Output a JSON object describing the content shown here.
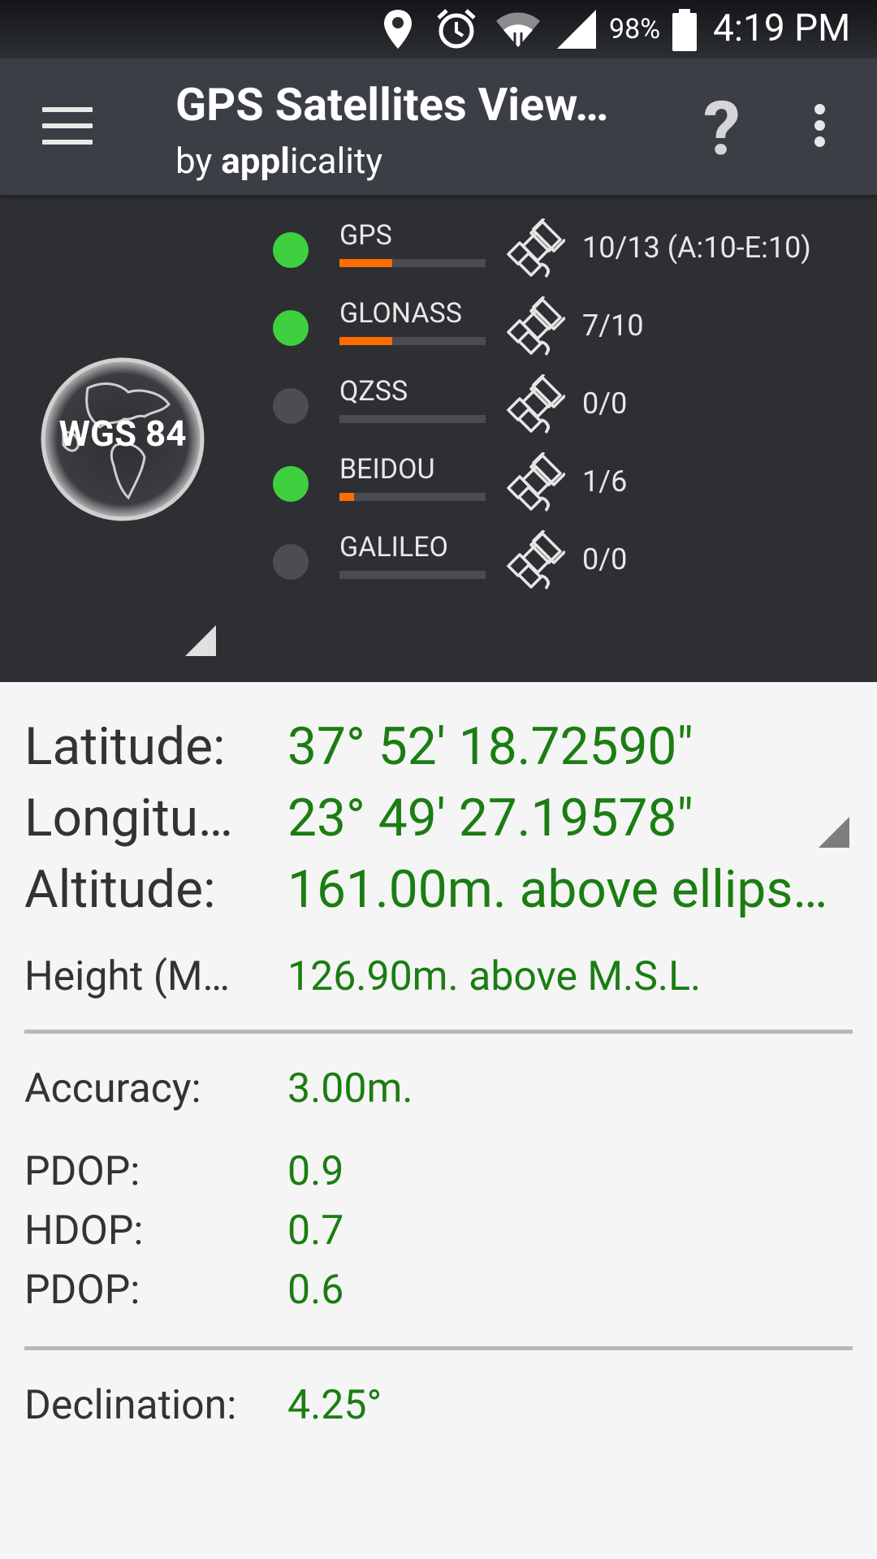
{
  "status_bar": {
    "battery_percent": "98%",
    "time": "4:19 PM",
    "icons": [
      "location-icon",
      "alarm-icon",
      "wifi-icon",
      "signal-icon",
      "battery-icon"
    ]
  },
  "app_bar": {
    "title": "GPS Satellites View…",
    "subtitle_prefix": "by ",
    "subtitle_bold": "appl",
    "subtitle_rest": "icality",
    "help_label": "?"
  },
  "satellites": {
    "datum": "WGS 84",
    "systems": [
      {
        "name": "GPS",
        "status": "active",
        "bar_fraction": 0.36,
        "count": "10/13 (A:10-E:10)"
      },
      {
        "name": "GLONASS",
        "status": "active",
        "bar_fraction": 0.36,
        "count": "7/10"
      },
      {
        "name": "QZSS",
        "status": "inactive",
        "bar_fraction": 0,
        "count": "0/0"
      },
      {
        "name": "BEIDOU",
        "status": "active",
        "bar_fraction": 0.1,
        "count": "1/6"
      },
      {
        "name": "GALILEO",
        "status": "inactive",
        "bar_fraction": 0,
        "count": "0/0"
      }
    ],
    "colors": {
      "active": "#3fd03f",
      "inactive": "#4b4d52",
      "bar": "#ff6d00"
    }
  },
  "location": {
    "latitude_label": "Latitude:",
    "latitude_value": "37° 52' 18.72590\"",
    "longitude_label": "Longitu…",
    "longitude_value": "23° 49' 27.19578\"",
    "altitude_label": "Altitude:",
    "altitude_value": "161.00m. above ellips…",
    "height_label": "Height (M…",
    "height_value": "126.90m. above M.S.L."
  },
  "accuracy": {
    "accuracy_label": "Accuracy:",
    "accuracy_value": "3.00m.",
    "pdop_label": "PDOP:",
    "pdop_value": "0.9",
    "hdop_label": "HDOP:",
    "hdop_value": "0.7",
    "vdop_label": "PDOP:",
    "vdop_value": "0.6"
  },
  "declination": {
    "label": "Declination:",
    "value": "4.25°"
  },
  "colors": {
    "value_green": "#1b7d12",
    "panel_bg": "#2d2f33",
    "appbar_bg": "#3b3f45"
  }
}
